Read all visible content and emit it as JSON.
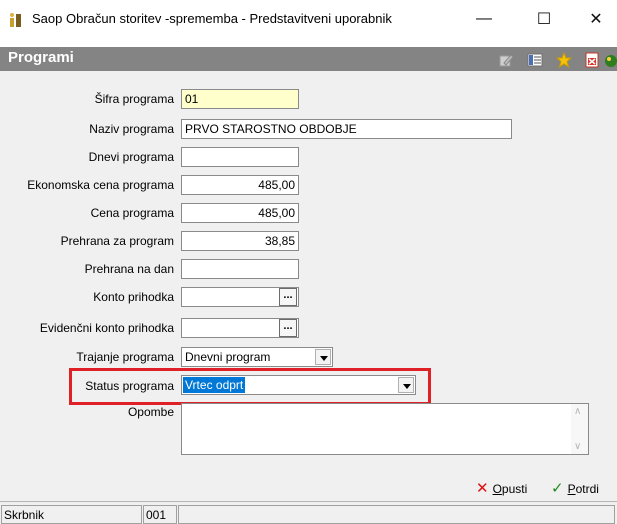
{
  "window": {
    "title": "Saop Obračun storitev -sprememba - Predstavitveni uporabnik",
    "minimize": "—",
    "maximize": "☐",
    "close": "✕"
  },
  "header": {
    "title": "Programi",
    "tools": [
      "edit-icon",
      "list-icon",
      "star-icon",
      "excel-icon",
      "exit-icon"
    ]
  },
  "form": {
    "sifra": {
      "label": "Šifra programa",
      "value": "01"
    },
    "naziv": {
      "label": "Naziv programa",
      "value": "PRVO STAROSTNO OBDOBJE"
    },
    "dnevi": {
      "label": "Dnevi programa",
      "value": ""
    },
    "ekonomska": {
      "label": "Ekonomska cena programa",
      "value": "485,00"
    },
    "cena": {
      "label": "Cena programa",
      "value": "485,00"
    },
    "prehrana_program": {
      "label": "Prehrana za program",
      "value": "38,85"
    },
    "prehrana_dan": {
      "label": "Prehrana na dan",
      "value": ""
    },
    "konto": {
      "label": "Konto prihodka",
      "value": "",
      "button": "..."
    },
    "evidencni": {
      "label": "Evidenčni konto prihodka",
      "value": "",
      "button": "..."
    },
    "trajanje": {
      "label": "Trajanje programa",
      "value": "Dnevni program"
    },
    "status": {
      "label": "Status programa",
      "value": "Vrtec odprt"
    },
    "opombe": {
      "label": "Opombe",
      "value": ""
    }
  },
  "actions": {
    "cancel_prefix": "O",
    "cancel_rest": "pusti",
    "confirm_prefix": "P",
    "confirm_rest": "otrdi"
  },
  "statusbar": {
    "user_label": "Skrbnik",
    "code": "001",
    "empty": ""
  },
  "colors": {
    "header_bg": "#848484",
    "highlight": "#e02027",
    "selection": "#0078d7",
    "yellow_field": "#ffffcc"
  }
}
